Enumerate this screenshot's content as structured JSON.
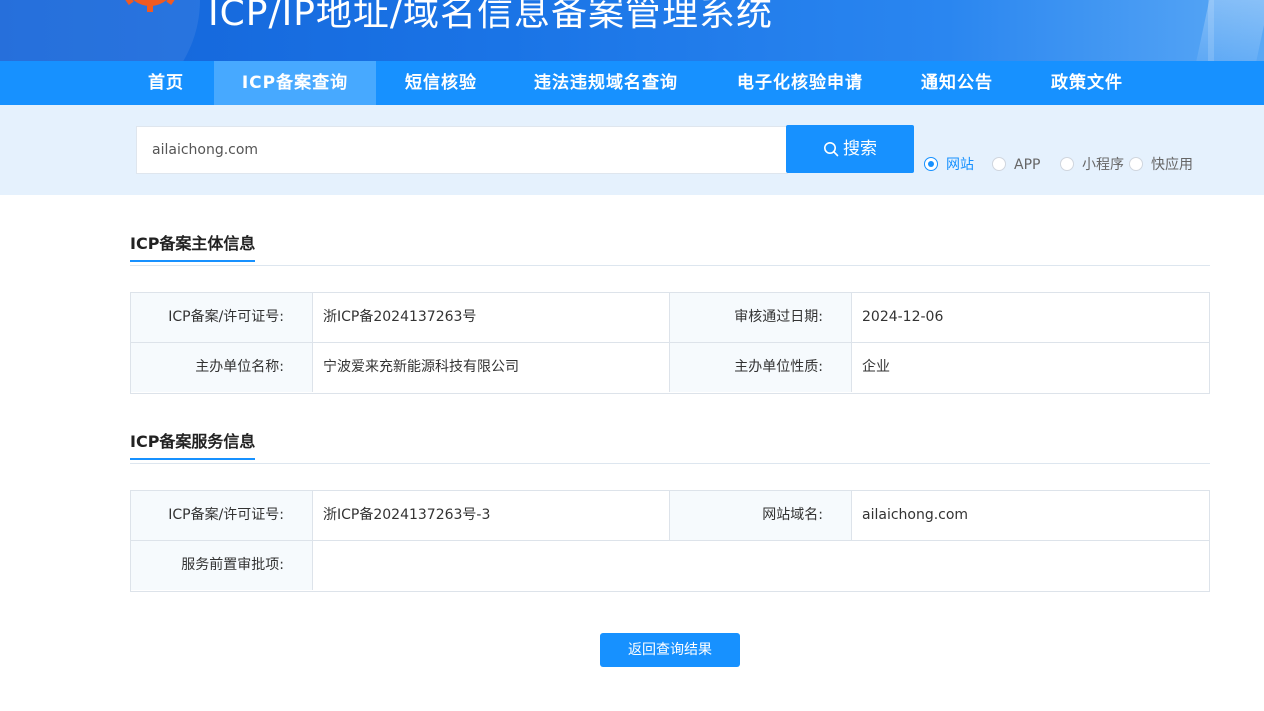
{
  "header": {
    "site_title": "ICP/IP地址/域名信息备案管理系统"
  },
  "nav": {
    "items": [
      {
        "label": "首页"
      },
      {
        "label": "ICP备案查询",
        "active": true
      },
      {
        "label": "短信核验"
      },
      {
        "label": "违法违规域名查询"
      },
      {
        "label": "电子化核验申请"
      },
      {
        "label": "通知公告"
      },
      {
        "label": "政策文件"
      }
    ]
  },
  "search": {
    "value": "ailaichong.com",
    "button_label": "搜索",
    "types": [
      {
        "label": "网站",
        "selected": true
      },
      {
        "label": "APP",
        "selected": false
      },
      {
        "label": "小程序",
        "selected": false
      },
      {
        "label": "快应用",
        "selected": false
      }
    ]
  },
  "entity_section": {
    "title": "ICP备案主体信息",
    "license_label": "ICP备案/许可证号:",
    "license_value": "浙ICP备2024137263号",
    "approval_date_label": "审核通过日期:",
    "approval_date_value": "2024-12-06",
    "org_name_label": "主办单位名称:",
    "org_name_value": "宁波爱来充新能源科技有限公司",
    "org_type_label": "主办单位性质:",
    "org_type_value": "企业"
  },
  "service_section": {
    "title": "ICP备案服务信息",
    "license_label": "ICP备案/许可证号:",
    "license_value": "浙ICP备2024137263号-3",
    "domain_label": "网站域名:",
    "domain_value": "ailaichong.com",
    "pre_approval_label": "服务前置审批项:",
    "pre_approval_value": ""
  },
  "back_button_label": "返回查询结果",
  "colors": {
    "primary": "#1791ff",
    "nav_active": "#47a9ff",
    "search_band": "#e5f1fd",
    "label_bg": "#f6fafd"
  }
}
